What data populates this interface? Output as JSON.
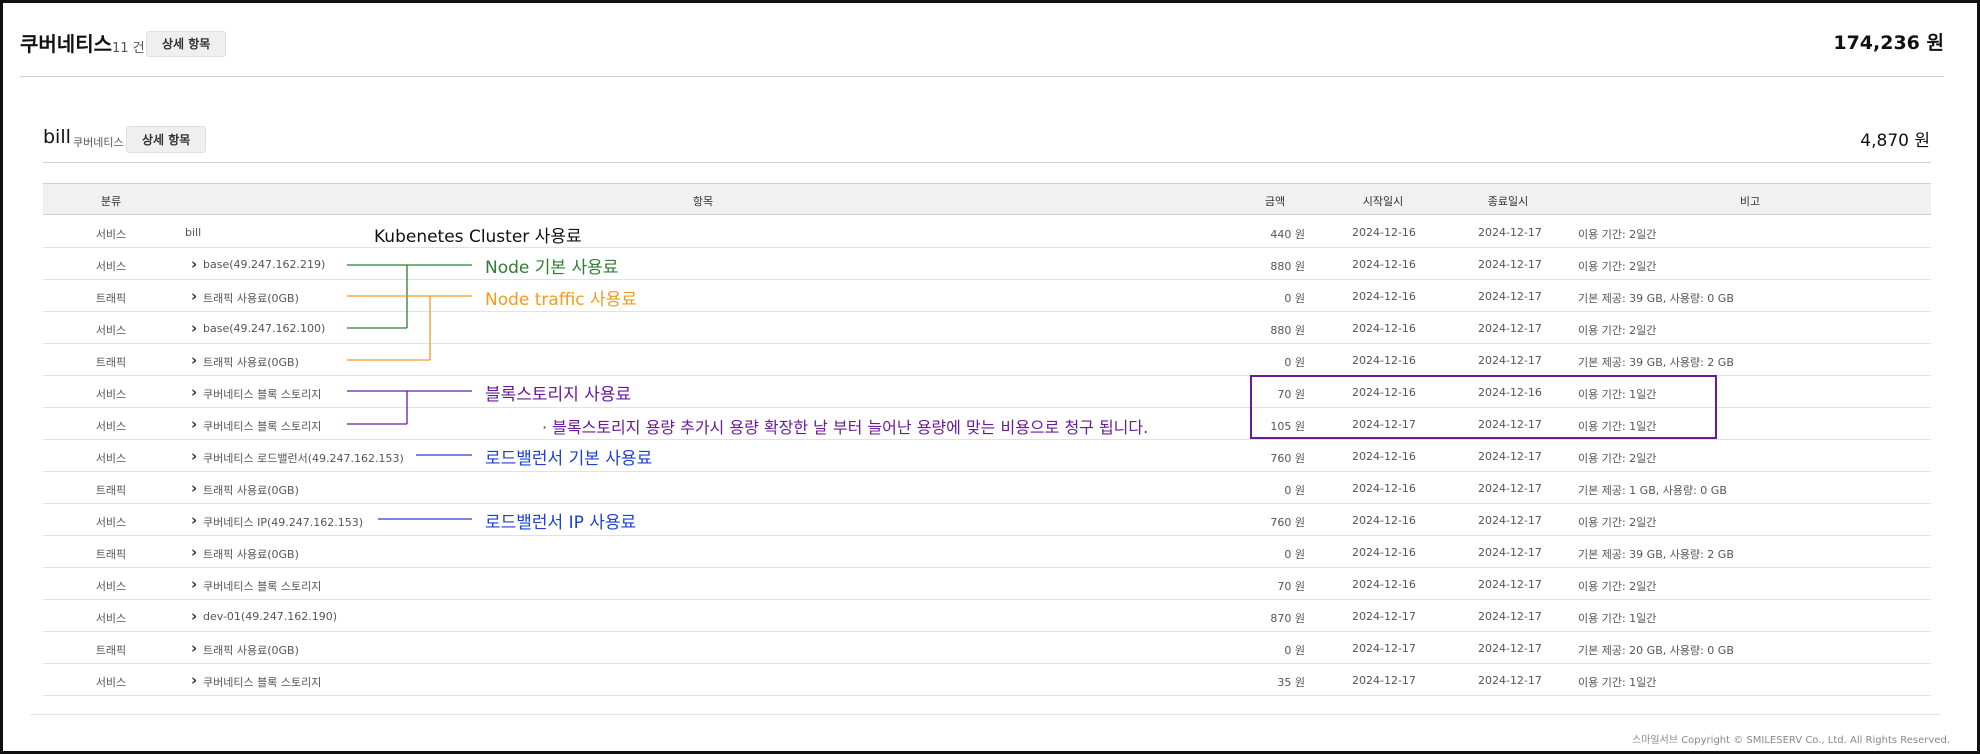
{
  "section": {
    "title": "쿠버네티스",
    "count": "11 건",
    "detail_button": "상세 항목",
    "total": "174,236 원"
  },
  "bill": {
    "title": "bill",
    "subtitle": "쿠버네티스",
    "detail_button": "상세 항목",
    "total": "4,870 원"
  },
  "table": {
    "headers": {
      "category": "분류",
      "item": "항목",
      "amount": "금액",
      "start": "시작일시",
      "end": "종료일시",
      "note": "비고"
    },
    "rows": [
      {
        "category": "서비스",
        "item": "bill",
        "sub": false,
        "amount": "440 원",
        "start": "2024-12-16",
        "end": "2024-12-17",
        "note": "이용 기간: 2일간"
      },
      {
        "category": "서비스",
        "item": "base(49.247.162.219)",
        "sub": true,
        "amount": "880 원",
        "start": "2024-12-16",
        "end": "2024-12-17",
        "note": "이용 기간: 2일간"
      },
      {
        "category": "트래픽",
        "item": "트래픽 사용료(0GB)",
        "sub": true,
        "amount": "0 원",
        "start": "2024-12-16",
        "end": "2024-12-17",
        "note": "기본 제공: 39 GB, 사용량: 0 GB"
      },
      {
        "category": "서비스",
        "item": "base(49.247.162.100)",
        "sub": true,
        "amount": "880 원",
        "start": "2024-12-16",
        "end": "2024-12-17",
        "note": "이용 기간: 2일간"
      },
      {
        "category": "트래픽",
        "item": "트래픽 사용료(0GB)",
        "sub": true,
        "amount": "0 원",
        "start": "2024-12-16",
        "end": "2024-12-17",
        "note": "기본 제공: 39 GB, 사용량: 2 GB"
      },
      {
        "category": "서비스",
        "item": "쿠버네티스 블록 스토리지",
        "sub": true,
        "amount": "70 원",
        "start": "2024-12-16",
        "end": "2024-12-16",
        "note": "이용 기간: 1일간"
      },
      {
        "category": "서비스",
        "item": "쿠버네티스 블록 스토리지",
        "sub": true,
        "amount": "105 원",
        "start": "2024-12-17",
        "end": "2024-12-17",
        "note": "이용 기간: 1일간"
      },
      {
        "category": "서비스",
        "item": "쿠버네티스 로드밸런서(49.247.162.153)",
        "sub": true,
        "amount": "760 원",
        "start": "2024-12-16",
        "end": "2024-12-17",
        "note": "이용 기간: 2일간"
      },
      {
        "category": "트래픽",
        "item": "트래픽 사용료(0GB)",
        "sub": true,
        "amount": "0 원",
        "start": "2024-12-16",
        "end": "2024-12-17",
        "note": "기본 제공: 1 GB, 사용량: 0 GB"
      },
      {
        "category": "서비스",
        "item": "쿠버네티스 IP(49.247.162.153)",
        "sub": true,
        "amount": "760 원",
        "start": "2024-12-16",
        "end": "2024-12-17",
        "note": "이용 기간: 2일간"
      },
      {
        "category": "트래픽",
        "item": "트래픽 사용료(0GB)",
        "sub": true,
        "amount": "0 원",
        "start": "2024-12-16",
        "end": "2024-12-17",
        "note": "기본 제공: 39 GB, 사용량: 2 GB"
      },
      {
        "category": "서비스",
        "item": "쿠버네티스 블록 스토리지",
        "sub": true,
        "amount": "70 원",
        "start": "2024-12-16",
        "end": "2024-12-17",
        "note": "이용 기간: 2일간"
      },
      {
        "category": "서비스",
        "item": "dev-01(49.247.162.190)",
        "sub": true,
        "amount": "870 원",
        "start": "2024-12-17",
        "end": "2024-12-17",
        "note": "이용 기간: 1일간"
      },
      {
        "category": "트래픽",
        "item": "트래픽 사용료(0GB)",
        "sub": true,
        "amount": "0 원",
        "start": "2024-12-17",
        "end": "2024-12-17",
        "note": "기본 제공: 20 GB, 사용량: 0 GB"
      },
      {
        "category": "서비스",
        "item": "쿠버네티스 블록 스토리지",
        "sub": true,
        "amount": "35 원",
        "start": "2024-12-17",
        "end": "2024-12-17",
        "note": "이용 기간: 1일간"
      }
    ]
  },
  "annotations": {
    "cluster": "Kubenetes Cluster  사용료",
    "node_base": "Node 기본 사용료",
    "node_traffic": "Node traffic 사용료",
    "block_storage": "블록스토리지 사용료",
    "block_storage_note": "· 블록스토리지 용량 추가시  용량 확장한 날 부터 늘어난 용량에 맞는 비용으로 청구 됩니다.",
    "lb_base": "로드밸런서 기본 사용료",
    "lb_ip": "로드밸런서 IP 사용료"
  },
  "footer": "스마일서브 Copyright © SMILESERV Co., Ltd. All Rights Reserved.",
  "colors": {
    "green": "#2e7d32",
    "orange": "#f59a1c",
    "purple": "#6a1b9a",
    "blue": "#1e40d8"
  }
}
